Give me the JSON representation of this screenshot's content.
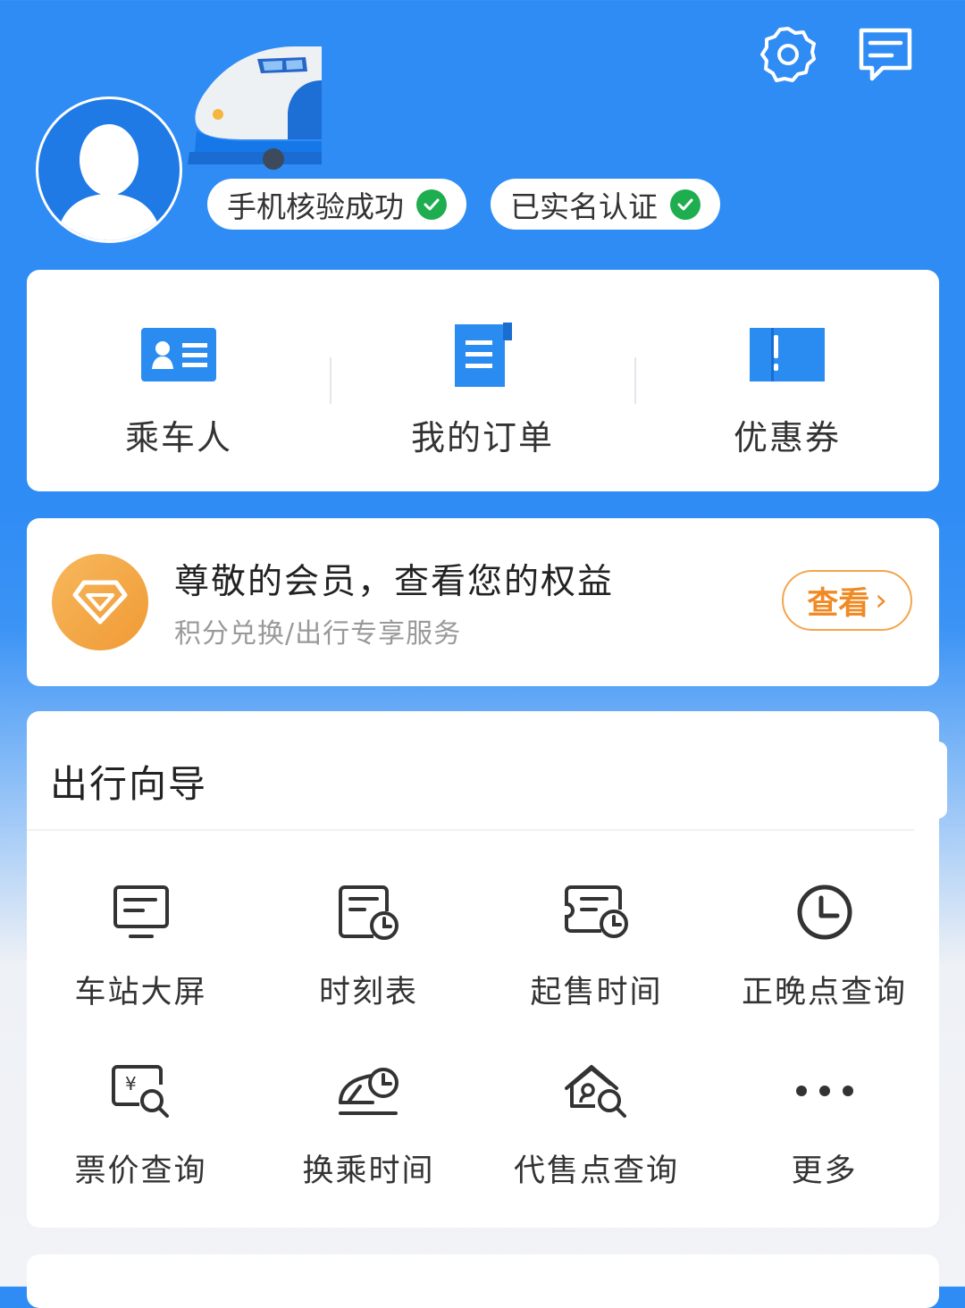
{
  "colors": {
    "primary_blue": "#2f8cf5",
    "icon_blue": "#2a8cf0",
    "verified_green": "#1fae4f",
    "member_orange": "#f08a24"
  },
  "header": {
    "settings_icon": "gear-icon",
    "message_icon": "message-icon",
    "badges": [
      {
        "label": "手机核验成功",
        "icon": "check-circle-icon"
      },
      {
        "label": "已实名认证",
        "icon": "check-circle-icon"
      }
    ]
  },
  "quick_actions": [
    {
      "label": "乘车人",
      "icon": "id-card-icon"
    },
    {
      "label": "我的订单",
      "icon": "order-document-icon"
    },
    {
      "label": "优惠券",
      "icon": "ticket-icon"
    }
  ],
  "member": {
    "title": "尊敬的会员，查看您的权益",
    "subtitle": "积分兑换/出行专享服务",
    "button": "查看",
    "icon": "diamond-icon"
  },
  "guide": {
    "title": "出行向导",
    "items": [
      {
        "label": "车站大屏",
        "icon": "screen-icon"
      },
      {
        "label": "时刻表",
        "icon": "timetable-icon"
      },
      {
        "label": "起售时间",
        "icon": "ticket-clock-icon"
      },
      {
        "label": "正晚点查询",
        "icon": "clock-icon"
      },
      {
        "label": "票价查询",
        "icon": "price-search-icon"
      },
      {
        "label": "换乘时间",
        "icon": "transfer-clock-icon"
      },
      {
        "label": "代售点查询",
        "icon": "agency-search-icon"
      },
      {
        "label": "更多",
        "icon": "more-dots-icon"
      }
    ]
  }
}
